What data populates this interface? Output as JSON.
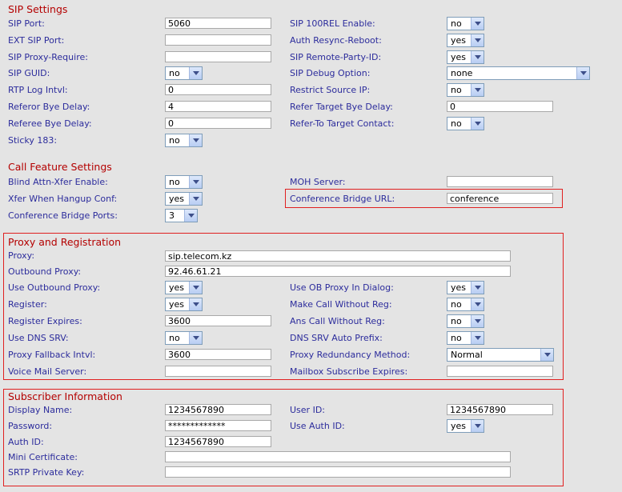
{
  "sip": {
    "title": "SIP Settings",
    "left": [
      {
        "label": "SIP Port:",
        "type": "text",
        "value": "5060"
      },
      {
        "label": "EXT SIP Port:",
        "type": "text",
        "value": ""
      },
      {
        "label": "SIP Proxy-Require:",
        "type": "text",
        "value": ""
      },
      {
        "label": "SIP GUID:",
        "type": "select",
        "value": "no"
      },
      {
        "label": "RTP Log Intvl:",
        "type": "text",
        "value": "0"
      },
      {
        "label": "Referor Bye Delay:",
        "type": "text",
        "value": "4"
      },
      {
        "label": "Referee Bye Delay:",
        "type": "text",
        "value": "0"
      },
      {
        "label": "Sticky 183:",
        "type": "select",
        "value": "no"
      }
    ],
    "right": [
      {
        "label": "SIP 100REL Enable:",
        "type": "select",
        "value": "no"
      },
      {
        "label": "Auth Resync-Reboot:",
        "type": "select",
        "value": "yes"
      },
      {
        "label": "SIP Remote-Party-ID:",
        "type": "select",
        "value": "yes"
      },
      {
        "label": "SIP Debug Option:",
        "type": "select",
        "value": "none"
      },
      {
        "label": "Restrict Source IP:",
        "type": "select",
        "value": "no"
      },
      {
        "label": "Refer Target Bye Delay:",
        "type": "text",
        "value": "0"
      },
      {
        "label": "Refer-To Target Contact:",
        "type": "select",
        "value": "no"
      }
    ]
  },
  "call": {
    "title": "Call Feature Settings",
    "left": [
      {
        "label": "Blind Attn-Xfer Enable:",
        "type": "select",
        "value": "no"
      },
      {
        "label": "Xfer When Hangup Conf:",
        "type": "select",
        "value": "yes"
      },
      {
        "label": "Conference Bridge Ports:",
        "type": "select",
        "value": "3"
      }
    ],
    "right": [
      {
        "label": "MOH Server:",
        "type": "text",
        "value": ""
      },
      {
        "label": "Conference Bridge URL:",
        "type": "text",
        "value": "conference"
      }
    ]
  },
  "proxy": {
    "title": "Proxy and Registration",
    "proxy_label": "Proxy:",
    "proxy_value": "sip.telecom.kz",
    "outbound_label": "Outbound Proxy:",
    "outbound_value": "92.46.61.21",
    "left": [
      {
        "label": "Use Outbound Proxy:",
        "type": "select",
        "value": "yes"
      },
      {
        "label": "Register:",
        "type": "select",
        "value": "yes"
      },
      {
        "label": "Register Expires:",
        "type": "text",
        "value": "3600"
      },
      {
        "label": "Use DNS SRV:",
        "type": "select",
        "value": "no"
      },
      {
        "label": "Proxy Fallback Intvl:",
        "type": "text",
        "value": "3600"
      },
      {
        "label": "Voice Mail Server:",
        "type": "text",
        "value": ""
      }
    ],
    "right": [
      {
        "label": "Use OB Proxy In Dialog:",
        "type": "select",
        "value": "yes"
      },
      {
        "label": "Make Call Without Reg:",
        "type": "select",
        "value": "no"
      },
      {
        "label": "Ans Call Without Reg:",
        "type": "select",
        "value": "no"
      },
      {
        "label": "DNS SRV Auto Prefix:",
        "type": "select",
        "value": "no"
      },
      {
        "label": "Proxy Redundancy Method:",
        "type": "select",
        "value": "Normal"
      },
      {
        "label": "Mailbox Subscribe Expires:",
        "type": "text",
        "value": ""
      }
    ]
  },
  "sub": {
    "title": "Subscriber Information",
    "display_label": "Display Name:",
    "display_value": "1234567890",
    "userid_label": "User ID:",
    "userid_value": "1234567890",
    "password_label": "Password:",
    "password_value": "*************",
    "authid_use_label": "Use Auth ID:",
    "authid_use_value": "yes",
    "authid_label": "Auth ID:",
    "authid_value": "1234567890",
    "mini_label": "Mini Certificate:",
    "mini_value": "",
    "srtp_label": "SRTP Private Key:",
    "srtp_value": ""
  },
  "colors": {
    "section": "#b40000",
    "label": "#2c2c9c",
    "highlight": "#e02020"
  }
}
